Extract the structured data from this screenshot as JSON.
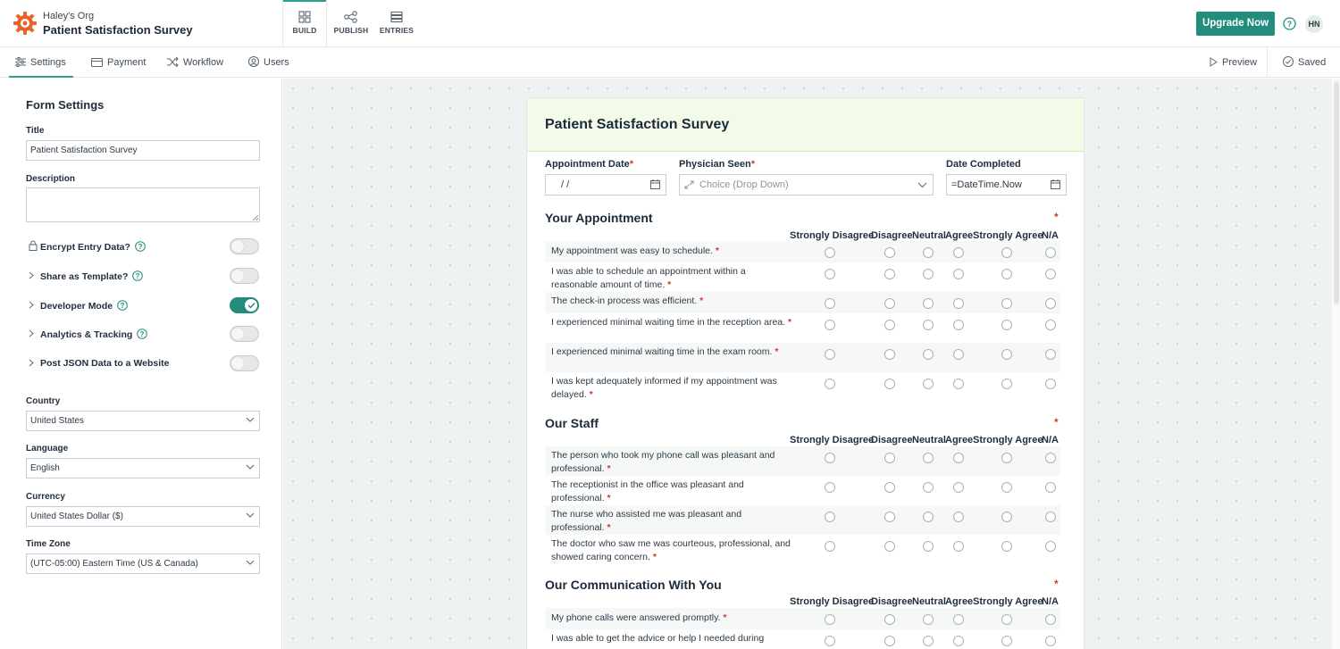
{
  "topbar": {
    "org_name": "Haley's Org",
    "form_title": "Patient Satisfaction Survey",
    "tabs": [
      {
        "label": "BUILD",
        "icon": "build-icon",
        "active": true
      },
      {
        "label": "PUBLISH",
        "icon": "share-icon",
        "active": false
      },
      {
        "label": "ENTRIES",
        "icon": "entries-icon",
        "active": false
      }
    ],
    "upgrade_label": "Upgrade Now",
    "avatar_initials": "HN",
    "accent_color": "#238d7d"
  },
  "subbar": {
    "tabs": [
      {
        "label": "Settings",
        "icon": "sliders-icon",
        "active": true
      },
      {
        "label": "Payment",
        "icon": "card-icon"
      },
      {
        "label": "Workflow",
        "icon": "shuffle-icon"
      },
      {
        "label": "Users",
        "icon": "user-icon"
      }
    ],
    "preview_label": "Preview",
    "saved_label": "Saved"
  },
  "settings": {
    "heading": "Form Settings",
    "title_label": "Title",
    "title_value": "Patient Satisfaction Survey",
    "description_label": "Description",
    "description_value": "",
    "toggles": [
      {
        "label": "Encrypt Entry Data?",
        "icon": "lock-icon",
        "help": true,
        "on": false
      },
      {
        "label": "Share as Template?",
        "icon": "chevron-right-icon",
        "help": true,
        "on": false
      },
      {
        "label": "Developer Mode",
        "icon": "chevron-right-icon",
        "help": true,
        "on": true
      },
      {
        "label": "Analytics & Tracking",
        "icon": "chevron-right-icon",
        "help": true,
        "on": false
      },
      {
        "label": "Post JSON Data to a Website",
        "icon": "chevron-right-icon",
        "help": false,
        "on": false
      }
    ],
    "country_label": "Country",
    "country_value": "United States",
    "language_label": "Language",
    "language_value": "English",
    "currency_label": "Currency",
    "currency_value": "United States Dollar ($)",
    "timezone_label": "Time Zone",
    "timezone_value": "(UTC-05:00) Eastern Time (US & Canada)"
  },
  "form": {
    "title": "Patient Satisfaction Survey",
    "appointment_date_label": "Appointment Date",
    "appointment_date_value": "/    /",
    "physician_label": "Physician Seen",
    "physician_placeholder": "Choice (Drop Down)",
    "date_completed_label": "Date Completed",
    "date_completed_value": "=DateTime.Now",
    "columns": [
      "Strongly Disagree",
      "Disagree",
      "Neutral",
      "Agree",
      "Strongly Agree",
      "N/A"
    ],
    "sections": [
      {
        "title": "Your Appointment",
        "rows": [
          "My appointment was easy to schedule.",
          "I was able to schedule an appointment within a reasonable amount of time.",
          "The check-in process was efficient.",
          "I experienced minimal waiting time in the reception area.",
          "I experienced minimal waiting time in the exam room.",
          "I was kept adequately informed if my appointment was delayed."
        ]
      },
      {
        "title": "Our Staff",
        "rows": [
          "The person who took my phone call was pleasant and professional.",
          "The receptionist in the office was pleasant and professional.",
          "The nurse who assisted me was pleasant and professional.",
          "The doctor who saw me was courteous, professional, and showed caring concern."
        ]
      },
      {
        "title": "Our Communication With You",
        "rows": [
          "My phone calls were answered promptly.",
          "I was able to get the advice or help I needed during"
        ]
      }
    ]
  }
}
